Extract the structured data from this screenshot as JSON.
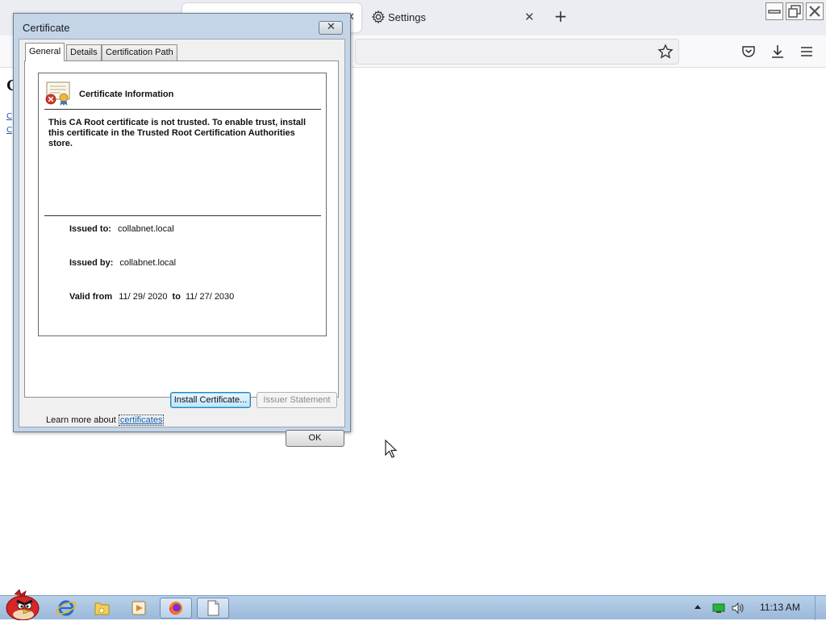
{
  "browser": {
    "tabs": [
      {
        "label": "",
        "active": true
      },
      {
        "label": "Settings",
        "active": false
      }
    ],
    "new_tab_label": "+",
    "page_fragments": [
      "C",
      "C",
      "C"
    ]
  },
  "dialog": {
    "title": "Certificate",
    "tabs": [
      "General",
      "Details",
      "Certification Path"
    ],
    "info_title": "Certificate Information",
    "warning": "This CA Root certificate is not trusted. To enable trust, install this certificate in the Trusted Root Certification Authorities store.",
    "issued_to_label": "Issued to:",
    "issued_to": "collabnet.local",
    "issued_by_label": "Issued by:",
    "issued_by": "collabnet.local",
    "valid_from_label": "Valid from",
    "valid_from": "11/ 29/ 2020",
    "to_label": "to",
    "valid_to": "11/ 27/ 2030",
    "install_button": "Install Certificate...",
    "issuer_button": "Issuer Statement",
    "learn_more_text": "Learn more about",
    "learn_more_link": "certificates",
    "ok_button": "OK"
  },
  "taskbar": {
    "clock": "11:13 AM"
  },
  "colors": {
    "dialog_frame": "#c4d5e8",
    "link": "#0b5fb5",
    "taskbar": "#9ab8d9"
  },
  "icons": [
    "gear-icon",
    "close-icon",
    "plus-icon",
    "star-icon",
    "pocket-icon",
    "download-icon",
    "menu-icon",
    "certificate-icon",
    "angry-bird-icon",
    "ie-icon",
    "folder-icon",
    "media-player-icon",
    "firefox-icon",
    "notepad-icon",
    "network-icon",
    "volume-icon"
  ]
}
